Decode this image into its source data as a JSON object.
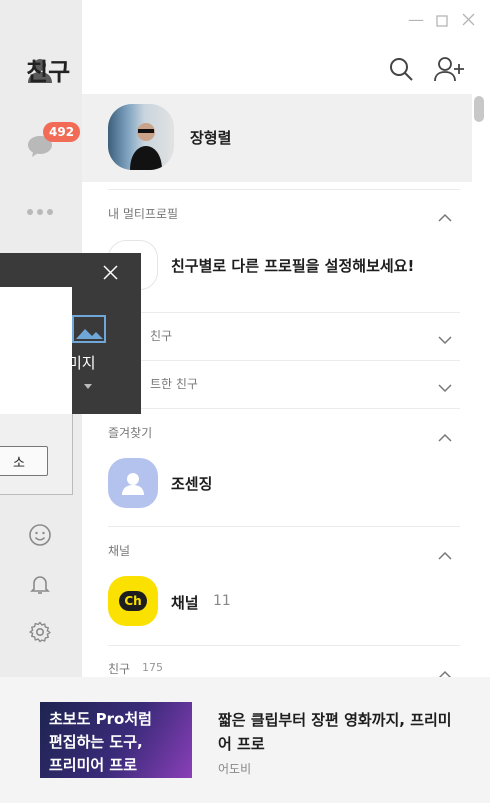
{
  "sidebar": {
    "chat_badge": "492"
  },
  "header": {
    "title": "친구"
  },
  "my_profile": {
    "name": "장형렬"
  },
  "sections": {
    "multi_profile": {
      "label": "내 멀티프로필",
      "promo": "친구별로 다른 프로필을 설정해보세요!"
    },
    "partial_1": {
      "label": "친구"
    },
    "partial_2": {
      "label": "트한 친구"
    },
    "favorites": {
      "label": "즐겨찾기",
      "item_name": "조센징"
    },
    "channels": {
      "label": "채널",
      "item_name": "채널",
      "item_count": "11",
      "logo_text": "Ch"
    },
    "friends": {
      "label": "친구",
      "count": "175"
    }
  },
  "dialog": {
    "image_label": "미지",
    "button_label": "소"
  },
  "ad": {
    "image_lines": [
      "초보도 Pro처럼",
      "편집하는 도구,",
      "프리미어 프로"
    ],
    "title": "짧은 클립부터 장편 영화까지, 프리미어 프로",
    "advertiser": "어도비"
  },
  "colors": {
    "badge": "#f26b57",
    "channel_yellow": "#fae100",
    "favorite_avatar": "#b4c2ee"
  }
}
